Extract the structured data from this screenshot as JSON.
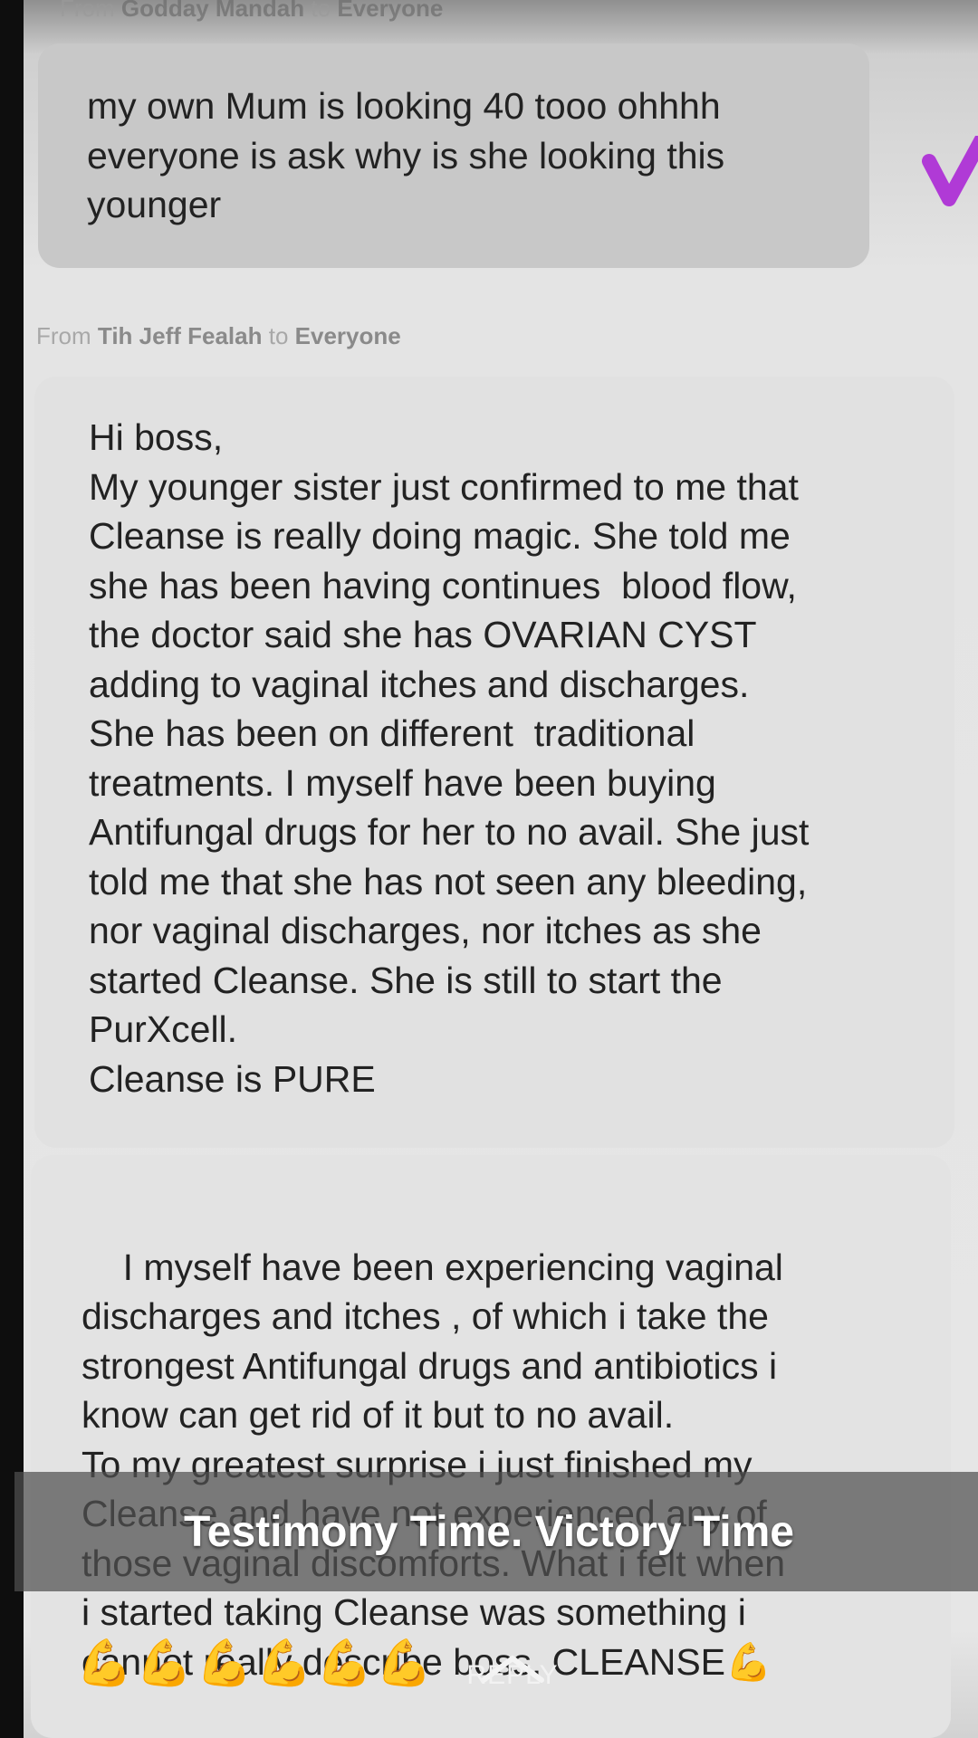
{
  "header": {
    "from_label": "From",
    "sender": "Godday Mandah",
    "to_label": "to",
    "recipient": "Everyone"
  },
  "message1": {
    "text": "my own Mum is looking 40 tooo ohhhh\neveryone is ask why is she looking this\nyounger"
  },
  "message2": {
    "from_label": "From",
    "sender": "Tih Jeff Fealah",
    "to_label": "to",
    "recipient": "Everyone",
    "text": "Hi boss,\nMy younger sister just confirmed to me that\nCleanse is really doing magic. She told me\nshe has been having continues  blood flow,\nthe doctor said she has OVARIAN CYST\nadding to vaginal itches and discharges.\nShe has been on different  traditional\ntreatments. I myself have been buying\nAntifungal drugs for her to no avail. She just\ntold me that she has not seen any bleeding,\nnor vaginal discharges, nor itches as she\nstarted Cleanse. She is still to start the\nPurXcell.\nCleanse is PURE"
  },
  "message3": {
    "text": "I myself have been experiencing vaginal\ndischarges and itches , of which i take the\nstrongest Antifungal drugs and antibiotics i\nknow can get rid of it but to no avail.\nTo my greatest surprise i just finished my\nCleanse and have not experienced any of\nthose vaginal discomforts. What i felt when\ni started taking Cleanse was something i\ncannot really describe boss. CLEANSE💪",
    "emojis": "💪💪💪💪💪💪"
  },
  "reply": {
    "label": "REPLY",
    "icon": "chevron-up-icon"
  },
  "caption": {
    "text": "Testimony Time. Victory Time"
  },
  "colors": {
    "accent_check": "#b03ad6",
    "caption_band": "#505050"
  }
}
